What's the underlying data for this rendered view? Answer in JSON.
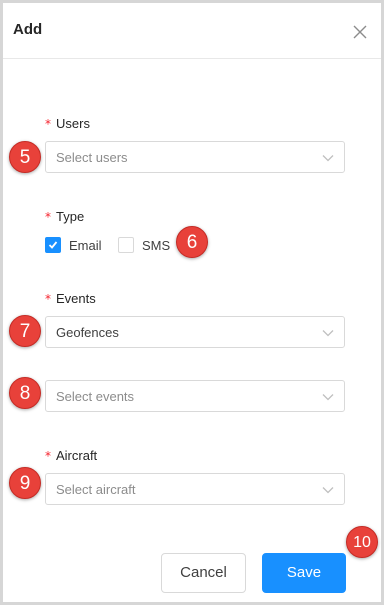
{
  "dialog": {
    "title": "Add",
    "close_icon": "close-icon"
  },
  "form": {
    "users": {
      "label": "Users",
      "required_marker": "*",
      "placeholder": "Select users"
    },
    "type": {
      "label": "Type",
      "required_marker": "*",
      "options": [
        {
          "label": "Email",
          "checked": true
        },
        {
          "label": "SMS",
          "checked": false
        }
      ]
    },
    "events": {
      "label": "Events",
      "required_marker": "*",
      "category_value": "Geofences",
      "events_placeholder": "Select events"
    },
    "aircraft": {
      "label": "Aircraft",
      "required_marker": "*",
      "placeholder": "Select aircraft"
    }
  },
  "footer": {
    "cancel_label": "Cancel",
    "save_label": "Save"
  },
  "annotations": [
    "5",
    "6",
    "7",
    "8",
    "9",
    "10"
  ],
  "colors": {
    "primary": "#1890ff",
    "required": "#f5222d",
    "badge": "#e8413a",
    "border": "#d9d9d9"
  }
}
